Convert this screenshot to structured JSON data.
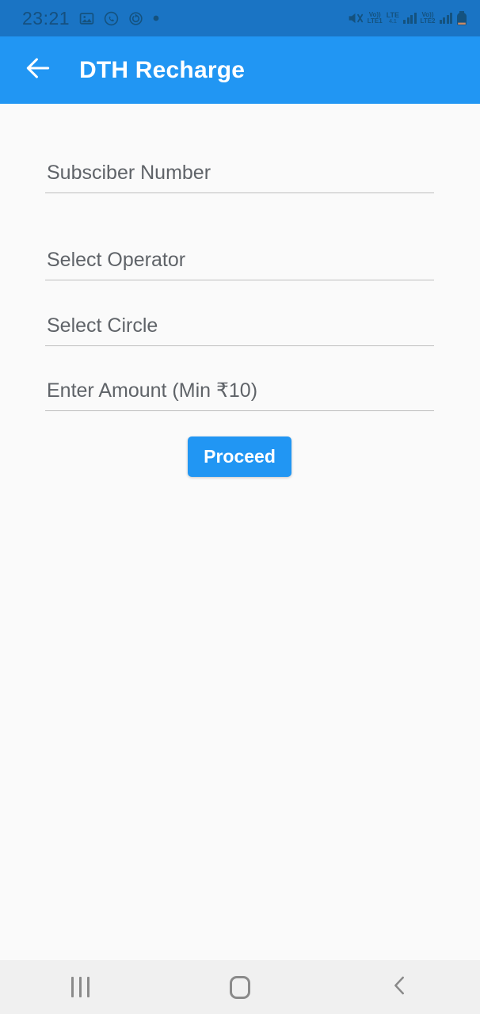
{
  "status_bar": {
    "clock": "23:21",
    "left_icons": [
      "gallery-icon",
      "whatsapp-icon",
      "alarm-icon",
      "dot-icon"
    ],
    "right_icons": [
      "mute-icon",
      "volte1-icon",
      "lte-icon",
      "signal1-icon",
      "volte2-icon",
      "signal2-icon",
      "battery-icon"
    ],
    "volte1_top": "Vo))",
    "volte1_bottom": "LTE1",
    "lte_top": "LTE",
    "lte_bottom": "4.1",
    "volte2_top": "Vo))",
    "volte2_bottom": "LTE2",
    "background_color": "#1a74c4",
    "foreground_color": "#14527f"
  },
  "app_bar": {
    "title": "DTH Recharge",
    "back_icon": "arrow-left-icon",
    "background_color": "#2196f3",
    "title_color": "#ffffff"
  },
  "form": {
    "fields": [
      {
        "name": "subscriber-number",
        "placeholder": "Subsciber Number",
        "value": ""
      },
      {
        "name": "select-operator",
        "placeholder": "Select Operator",
        "value": ""
      },
      {
        "name": "select-circle",
        "placeholder": "Select Circle",
        "value": ""
      },
      {
        "name": "enter-amount",
        "placeholder": "Enter Amount (Min ₹10)",
        "value": ""
      }
    ],
    "submit_label": "Proceed",
    "submit_color": "#2196f3",
    "label_color": "#5f6368",
    "underline_color": "#bdbdbd",
    "background_color": "#fafafa"
  },
  "nav_bar": {
    "recents_label": "recents-icon",
    "home_label": "home-icon",
    "back_label": "back-icon",
    "background_color": "#f0f0f0",
    "icon_color": "#8a8a8a"
  }
}
